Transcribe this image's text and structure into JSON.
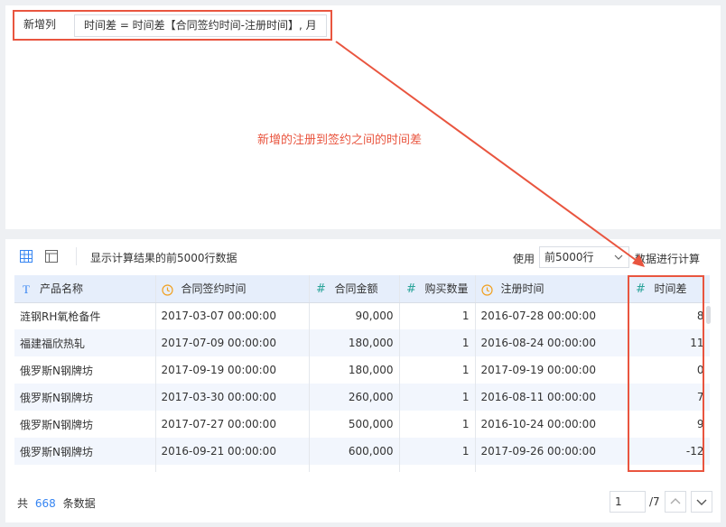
{
  "formula_editor": {
    "label": "新增列",
    "formula": "时间差 = 时间差【合同签约时间-注册时间】, 月"
  },
  "annotation": {
    "text": "新增的注册到签约之间的时间差",
    "color": "#e9553f"
  },
  "toolbar": {
    "grid_icon": "table-grid-icon",
    "layout_icon": "panel-layout-icon",
    "preview_text": "显示计算结果的前5000行数据",
    "use_label": "使用",
    "row_option": "前5000行",
    "calc_label": "数据进行计算"
  },
  "table": {
    "columns": [
      {
        "label": "产品名称",
        "type_icon": "text-type-icon"
      },
      {
        "label": "合同签约时间",
        "type_icon": "clock-icon"
      },
      {
        "label": "合同金额",
        "type_icon": "number-type-icon"
      },
      {
        "label": "购买数量",
        "type_icon": "number-type-icon"
      },
      {
        "label": "注册时间",
        "type_icon": "clock-icon"
      },
      {
        "label": "时间差",
        "type_icon": "number-type-icon"
      }
    ],
    "rows": [
      [
        "涟钢RH氧枪备件",
        "2017-03-07 00:00:00",
        "90,000",
        "1",
        "2016-07-28 00:00:00",
        "8"
      ],
      [
        "福建福欣热轧",
        "2017-07-09 00:00:00",
        "180,000",
        "1",
        "2016-08-24 00:00:00",
        "11"
      ],
      [
        "俄罗斯N钢牌坊",
        "2017-09-19 00:00:00",
        "180,000",
        "1",
        "2017-09-19 00:00:00",
        "0"
      ],
      [
        "俄罗斯N钢牌坊",
        "2017-03-30 00:00:00",
        "260,000",
        "1",
        "2016-08-11 00:00:00",
        "7"
      ],
      [
        "俄罗斯N钢牌坊",
        "2017-07-27 00:00:00",
        "500,000",
        "1",
        "2016-10-24 00:00:00",
        "9"
      ],
      [
        "俄罗斯N钢牌坊",
        "2016-09-21 00:00:00",
        "600,000",
        "1",
        "2017-09-26 00:00:00",
        "-12"
      ]
    ]
  },
  "footer": {
    "total_prefix": "共",
    "total_count": "668",
    "total_suffix": "条数据",
    "current_page": "1",
    "total_pages": "/7"
  },
  "colors": {
    "accent": "#3685f2",
    "highlight": "#e9553f",
    "header_bg": "#e6eefb",
    "number_icon": "#29a39a",
    "clock_icon": "#f0a020"
  }
}
